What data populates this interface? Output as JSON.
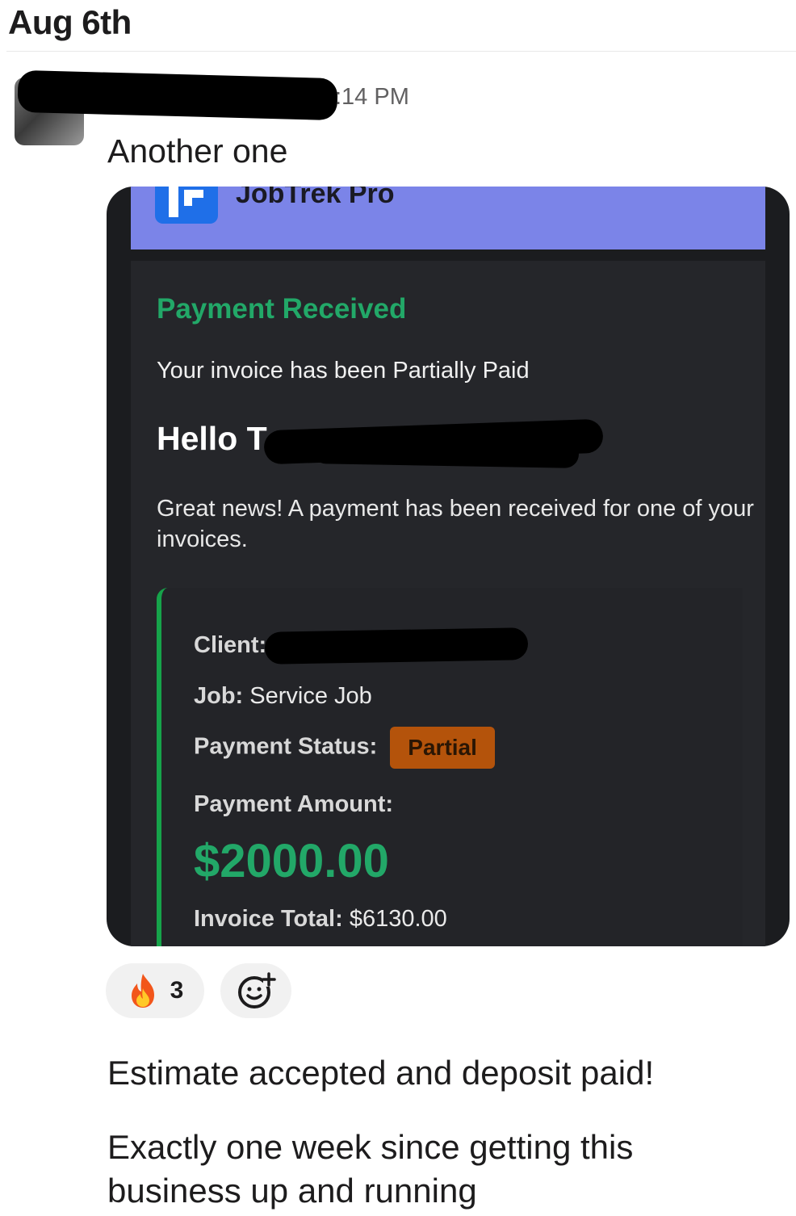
{
  "channel": {
    "date_header": "Aug 6th"
  },
  "message": {
    "time": ":14 PM",
    "text": "Another one"
  },
  "attachment": {
    "brand": "JobTrek Pro",
    "heading": "Payment Received",
    "subtitle": "Your invoice has been Partially Paid",
    "greeting": "Hello T",
    "body": "Great news! A payment has been received for one of your invoices.",
    "client_label": "Client:",
    "job_label": "Job:",
    "job_value": "Service Job",
    "status_label": "Payment Status:",
    "status_value": "Partial",
    "amount_label": "Payment Amount:",
    "amount_value": "$2000.00",
    "total_label": "Invoice Total:",
    "total_value": "$6130.00",
    "colors": {
      "banner": "#7b84e8",
      "success": "#22a868",
      "badge": "#b4530b"
    }
  },
  "reactions": [
    {
      "icon": "fire-icon",
      "count": "3"
    }
  ],
  "followups": [
    "Estimate accepted and deposit paid!",
    "Exactly one week since getting this business up and running"
  ]
}
